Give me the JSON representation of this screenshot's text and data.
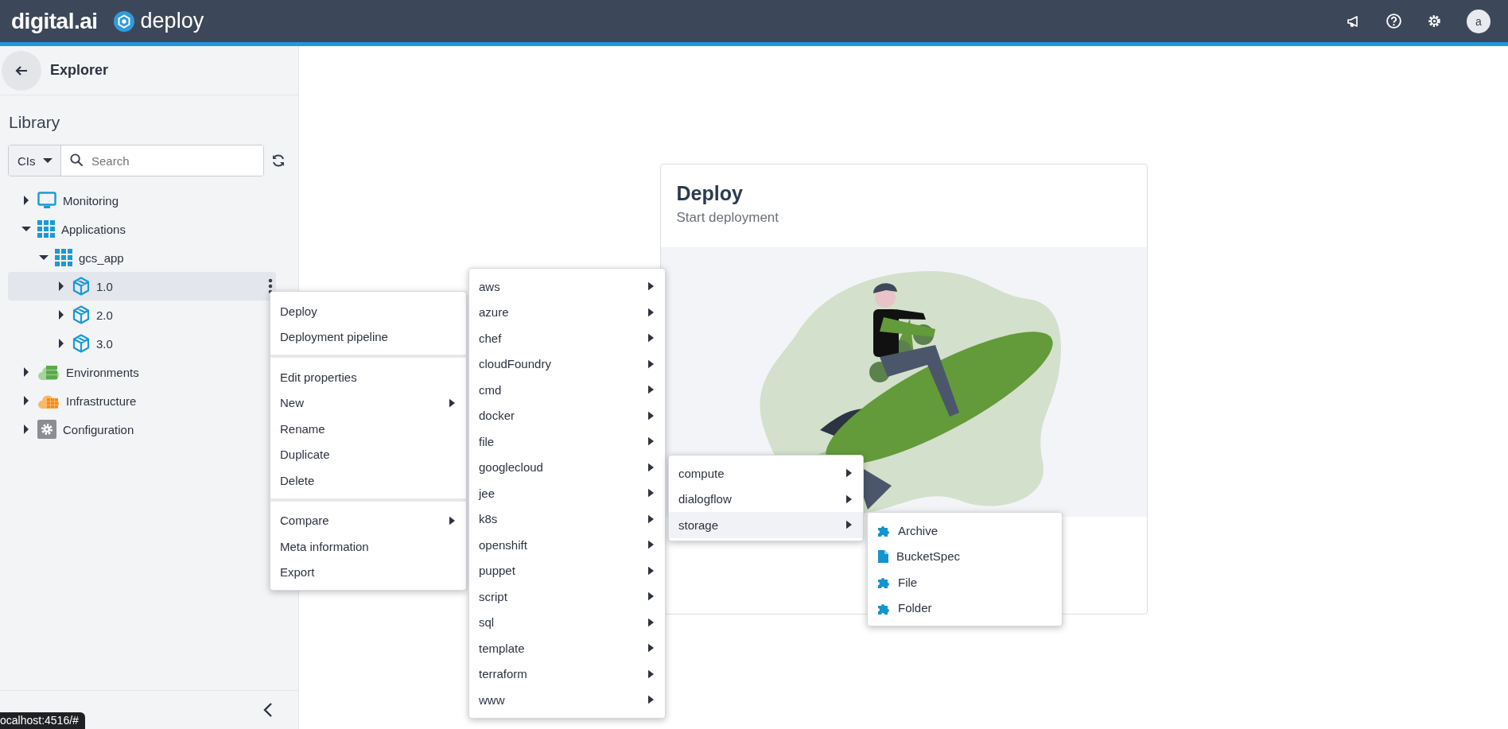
{
  "header": {
    "logo": "digital.ai",
    "product": "deploy",
    "avatar": "a"
  },
  "sidebar": {
    "title": "Explorer",
    "library_title": "Library",
    "filter": "CIs",
    "search": {
      "placeholder": "Search"
    },
    "tree": [
      {
        "label": "Monitoring",
        "kind": "monitor",
        "expanded": false,
        "selected": false
      },
      {
        "label": "Applications",
        "kind": "applications",
        "expanded": true,
        "selected": false,
        "children": [
          {
            "label": "gcs_app",
            "kind": "applications",
            "expanded": true,
            "selected": false,
            "children": [
              {
                "label": "1.0",
                "kind": "package",
                "expanded": false,
                "selected": true
              },
              {
                "label": "2.0",
                "kind": "package",
                "expanded": false,
                "selected": false
              },
              {
                "label": "3.0",
                "kind": "package",
                "expanded": false,
                "selected": false
              }
            ]
          }
        ]
      },
      {
        "label": "Environments",
        "kind": "environments",
        "expanded": false,
        "selected": false
      },
      {
        "label": "Infrastructure",
        "kind": "infrastructure",
        "expanded": false,
        "selected": false
      },
      {
        "label": "Configuration",
        "kind": "configuration",
        "expanded": false,
        "selected": false
      }
    ],
    "status_tooltip": "ocalhost:4516/#"
  },
  "card": {
    "title": "Deploy",
    "subtitle": "Start deployment"
  },
  "context_menu": {
    "sections": [
      {
        "items": [
          {
            "label": "Deploy",
            "submenu": false
          },
          {
            "label": "Deployment pipeline",
            "submenu": false
          }
        ]
      },
      {
        "items": [
          {
            "label": "Edit properties",
            "submenu": false
          },
          {
            "label": "New",
            "submenu": true
          },
          {
            "label": "Rename",
            "submenu": false
          },
          {
            "label": "Duplicate",
            "submenu": false
          },
          {
            "label": "Delete",
            "submenu": false
          }
        ]
      },
      {
        "items": [
          {
            "label": "Compare",
            "submenu": true
          },
          {
            "label": "Meta information",
            "submenu": false
          },
          {
            "label": "Export",
            "submenu": false
          }
        ]
      }
    ]
  },
  "type_menu": {
    "items": [
      {
        "label": "aws",
        "submenu": true
      },
      {
        "label": "azure",
        "submenu": true
      },
      {
        "label": "chef",
        "submenu": true
      },
      {
        "label": "cloudFoundry",
        "submenu": true
      },
      {
        "label": "cmd",
        "submenu": true
      },
      {
        "label": "docker",
        "submenu": true
      },
      {
        "label": "file",
        "submenu": true
      },
      {
        "label": "googlecloud",
        "submenu": true
      },
      {
        "label": "jee",
        "submenu": true
      },
      {
        "label": "k8s",
        "submenu": true
      },
      {
        "label": "openshift",
        "submenu": true
      },
      {
        "label": "puppet",
        "submenu": true
      },
      {
        "label": "script",
        "submenu": true
      },
      {
        "label": "sql",
        "submenu": true
      },
      {
        "label": "template",
        "submenu": true
      },
      {
        "label": "terraform",
        "submenu": true
      },
      {
        "label": "www",
        "submenu": true
      }
    ]
  },
  "subtype_menu": {
    "items": [
      {
        "label": "compute",
        "submenu": true,
        "selected": false
      },
      {
        "label": "dialogflow",
        "submenu": true,
        "selected": false
      },
      {
        "label": "storage",
        "submenu": true,
        "selected": true
      }
    ]
  },
  "leaf_menu": {
    "items": [
      {
        "label": "Archive",
        "kind": "plugin"
      },
      {
        "label": "BucketSpec",
        "kind": "document"
      },
      {
        "label": "File",
        "kind": "plugin"
      },
      {
        "label": "Folder",
        "kind": "plugin"
      }
    ]
  }
}
